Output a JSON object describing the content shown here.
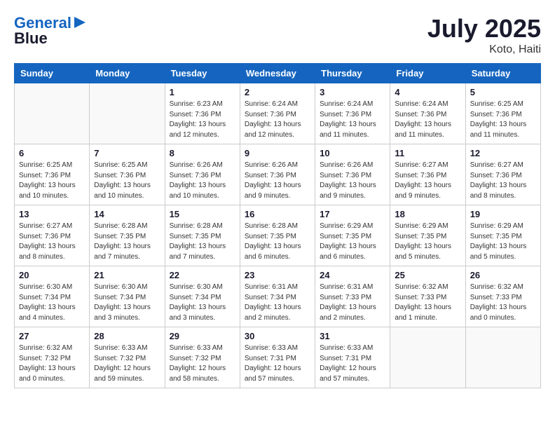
{
  "header": {
    "logo_line1": "General",
    "logo_line2": "Blue",
    "month_year": "July 2025",
    "location": "Koto, Haiti"
  },
  "weekdays": [
    "Sunday",
    "Monday",
    "Tuesday",
    "Wednesday",
    "Thursday",
    "Friday",
    "Saturday"
  ],
  "weeks": [
    [
      {
        "day": "",
        "detail": ""
      },
      {
        "day": "",
        "detail": ""
      },
      {
        "day": "1",
        "detail": "Sunrise: 6:23 AM\nSunset: 7:36 PM\nDaylight: 13 hours\nand 12 minutes."
      },
      {
        "day": "2",
        "detail": "Sunrise: 6:24 AM\nSunset: 7:36 PM\nDaylight: 13 hours\nand 12 minutes."
      },
      {
        "day": "3",
        "detail": "Sunrise: 6:24 AM\nSunset: 7:36 PM\nDaylight: 13 hours\nand 11 minutes."
      },
      {
        "day": "4",
        "detail": "Sunrise: 6:24 AM\nSunset: 7:36 PM\nDaylight: 13 hours\nand 11 minutes."
      },
      {
        "day": "5",
        "detail": "Sunrise: 6:25 AM\nSunset: 7:36 PM\nDaylight: 13 hours\nand 11 minutes."
      }
    ],
    [
      {
        "day": "6",
        "detail": "Sunrise: 6:25 AM\nSunset: 7:36 PM\nDaylight: 13 hours\nand 10 minutes."
      },
      {
        "day": "7",
        "detail": "Sunrise: 6:25 AM\nSunset: 7:36 PM\nDaylight: 13 hours\nand 10 minutes."
      },
      {
        "day": "8",
        "detail": "Sunrise: 6:26 AM\nSunset: 7:36 PM\nDaylight: 13 hours\nand 10 minutes."
      },
      {
        "day": "9",
        "detail": "Sunrise: 6:26 AM\nSunset: 7:36 PM\nDaylight: 13 hours\nand 9 minutes."
      },
      {
        "day": "10",
        "detail": "Sunrise: 6:26 AM\nSunset: 7:36 PM\nDaylight: 13 hours\nand 9 minutes."
      },
      {
        "day": "11",
        "detail": "Sunrise: 6:27 AM\nSunset: 7:36 PM\nDaylight: 13 hours\nand 9 minutes."
      },
      {
        "day": "12",
        "detail": "Sunrise: 6:27 AM\nSunset: 7:36 PM\nDaylight: 13 hours\nand 8 minutes."
      }
    ],
    [
      {
        "day": "13",
        "detail": "Sunrise: 6:27 AM\nSunset: 7:36 PM\nDaylight: 13 hours\nand 8 minutes."
      },
      {
        "day": "14",
        "detail": "Sunrise: 6:28 AM\nSunset: 7:35 PM\nDaylight: 13 hours\nand 7 minutes."
      },
      {
        "day": "15",
        "detail": "Sunrise: 6:28 AM\nSunset: 7:35 PM\nDaylight: 13 hours\nand 7 minutes."
      },
      {
        "day": "16",
        "detail": "Sunrise: 6:28 AM\nSunset: 7:35 PM\nDaylight: 13 hours\nand 6 minutes."
      },
      {
        "day": "17",
        "detail": "Sunrise: 6:29 AM\nSunset: 7:35 PM\nDaylight: 13 hours\nand 6 minutes."
      },
      {
        "day": "18",
        "detail": "Sunrise: 6:29 AM\nSunset: 7:35 PM\nDaylight: 13 hours\nand 5 minutes."
      },
      {
        "day": "19",
        "detail": "Sunrise: 6:29 AM\nSunset: 7:35 PM\nDaylight: 13 hours\nand 5 minutes."
      }
    ],
    [
      {
        "day": "20",
        "detail": "Sunrise: 6:30 AM\nSunset: 7:34 PM\nDaylight: 13 hours\nand 4 minutes."
      },
      {
        "day": "21",
        "detail": "Sunrise: 6:30 AM\nSunset: 7:34 PM\nDaylight: 13 hours\nand 3 minutes."
      },
      {
        "day": "22",
        "detail": "Sunrise: 6:30 AM\nSunset: 7:34 PM\nDaylight: 13 hours\nand 3 minutes."
      },
      {
        "day": "23",
        "detail": "Sunrise: 6:31 AM\nSunset: 7:34 PM\nDaylight: 13 hours\nand 2 minutes."
      },
      {
        "day": "24",
        "detail": "Sunrise: 6:31 AM\nSunset: 7:33 PM\nDaylight: 13 hours\nand 2 minutes."
      },
      {
        "day": "25",
        "detail": "Sunrise: 6:32 AM\nSunset: 7:33 PM\nDaylight: 13 hours\nand 1 minute."
      },
      {
        "day": "26",
        "detail": "Sunrise: 6:32 AM\nSunset: 7:33 PM\nDaylight: 13 hours\nand 0 minutes."
      }
    ],
    [
      {
        "day": "27",
        "detail": "Sunrise: 6:32 AM\nSunset: 7:32 PM\nDaylight: 13 hours\nand 0 minutes."
      },
      {
        "day": "28",
        "detail": "Sunrise: 6:33 AM\nSunset: 7:32 PM\nDaylight: 12 hours\nand 59 minutes."
      },
      {
        "day": "29",
        "detail": "Sunrise: 6:33 AM\nSunset: 7:32 PM\nDaylight: 12 hours\nand 58 minutes."
      },
      {
        "day": "30",
        "detail": "Sunrise: 6:33 AM\nSunset: 7:31 PM\nDaylight: 12 hours\nand 57 minutes."
      },
      {
        "day": "31",
        "detail": "Sunrise: 6:33 AM\nSunset: 7:31 PM\nDaylight: 12 hours\nand 57 minutes."
      },
      {
        "day": "",
        "detail": ""
      },
      {
        "day": "",
        "detail": ""
      }
    ]
  ]
}
